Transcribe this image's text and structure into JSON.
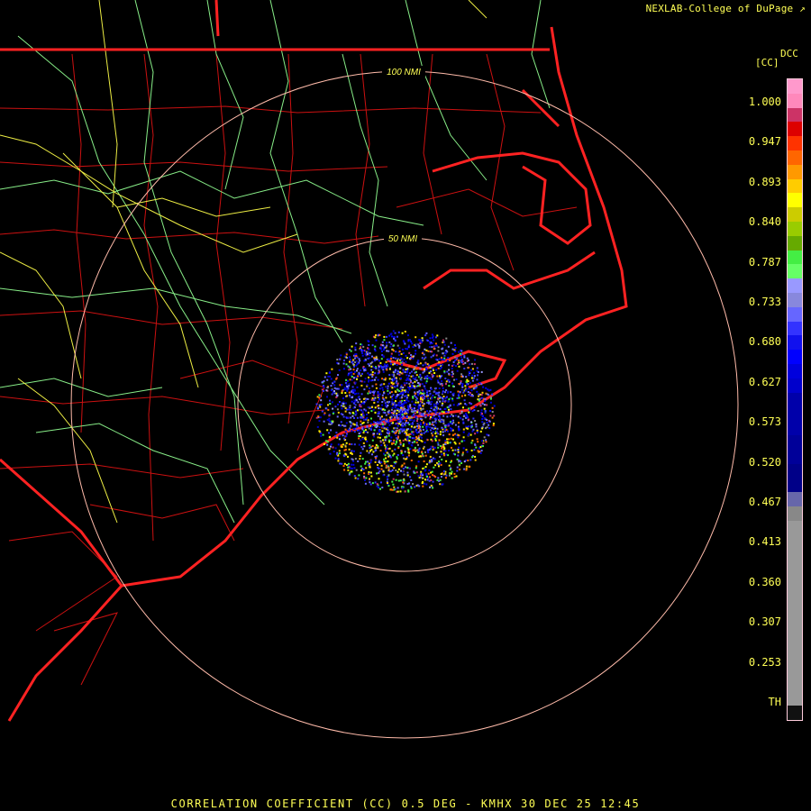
{
  "header": {
    "credit": "NEXLAB-College of DuPage"
  },
  "footer": {
    "caption": "CORRELATION COEFFICIENT (CC) 0.5 DEG - KMHX 30 DEC 25 12:45"
  },
  "legend": {
    "product_code": "DCC",
    "unit": "[CC]",
    "labels": [
      "1.000",
      "0.947",
      "0.893",
      "0.840",
      "0.787",
      "0.733",
      "0.680",
      "0.627",
      "0.573",
      "0.520",
      "0.467",
      "0.413",
      "0.360",
      "0.307",
      "0.253",
      "TH"
    ],
    "colors": [
      "#ff99cc",
      "#ff88bb",
      "#cc3366",
      "#dd0000",
      "#ff3300",
      "#ff6600",
      "#ff9900",
      "#ffcc00",
      "#ffff00",
      "#cccc00",
      "#99cc00",
      "#66aa00",
      "#44ee44",
      "#66ff66",
      "#9999ff",
      "#8888dd",
      "#6666ff",
      "#3333ff",
      "#1111ee",
      "#0000ff",
      "#0000dd",
      "#0000cc",
      "#0000aa",
      "#0000aa",
      "#0000aa",
      "#000099",
      "#000099",
      "#000088",
      "#000088",
      "#6666aa",
      "#888888",
      "#999999",
      "#999999",
      "#999999",
      "#999999",
      "#999999",
      "#999999",
      "#999999",
      "#999999",
      "#999999",
      "#999999",
      "#999999",
      "#999999",
      "#999999",
      "#111111"
    ]
  },
  "range_rings": {
    "inner_label": "50 NMI",
    "outer_label": "100 NMI"
  },
  "icons": {
    "credit_icon": "mouse-cursor-icon"
  }
}
